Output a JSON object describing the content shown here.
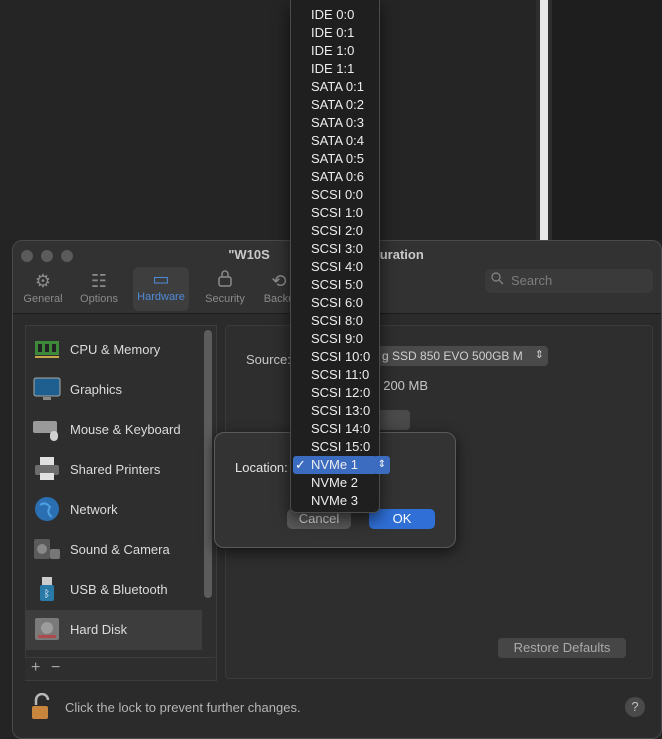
{
  "window": {
    "title": "\"W10S",
    "title_tail": "guration"
  },
  "toolbar": [
    {
      "label": "General",
      "icon": "gear-icon",
      "glyph": "⚙"
    },
    {
      "label": "Options",
      "icon": "sliders-icon",
      "glyph": "☷"
    },
    {
      "label": "Hardware",
      "icon": "monitor-icon",
      "glyph": "▭"
    },
    {
      "label": "Security",
      "icon": "lock-icon",
      "glyph": "🔒"
    },
    {
      "label": "Backu",
      "icon": "backup-icon",
      "glyph": "⟲"
    }
  ],
  "search": {
    "placeholder": "Search"
  },
  "sidebar": {
    "items": [
      {
        "label": "CPU & Memory",
        "icon": "cpu-icon",
        "color": "#3f8a3a"
      },
      {
        "label": "Graphics",
        "icon": "monitor-icon",
        "color": "#1f5f8f"
      },
      {
        "label": "Mouse & Keyboard",
        "icon": "keyboard-icon",
        "color": "#8a8a8a"
      },
      {
        "label": "Shared Printers",
        "icon": "printer-icon",
        "color": "#6d6d6d"
      },
      {
        "label": "Network",
        "icon": "globe-icon",
        "color": "#2b6fb3"
      },
      {
        "label": "Sound & Camera",
        "icon": "speaker-icon",
        "color": "#5a5a5a"
      },
      {
        "label": "USB & Bluetooth",
        "icon": "usb-icon",
        "color": "#2a7aa8"
      },
      {
        "label": "Hard Disk",
        "icon": "harddisk-icon",
        "color": "#7a7a7a"
      }
    ],
    "add": "+",
    "remove": "−"
  },
  "panel": {
    "source_label": "Source:",
    "source_value": "g SSD 850 EVO 500GB M",
    "size_text": ": 200 MB",
    "restore_label": "Restore Defaults"
  },
  "lock_text": "Click the lock to prevent further changes.",
  "help": "?",
  "sheet": {
    "location_label": "Location:",
    "cancel": "Cancel",
    "ok": "OK"
  },
  "menu": {
    "options": [
      "IDE 0:0",
      "IDE 0:1",
      "IDE 1:0",
      "IDE 1:1",
      "SATA 0:1",
      "SATA 0:2",
      "SATA 0:3",
      "SATA 0:4",
      "SATA 0:5",
      "SATA 0:6",
      "SCSI 0:0",
      "SCSI 1:0",
      "SCSI 2:0",
      "SCSI 3:0",
      "SCSI 4:0",
      "SCSI 5:0",
      "SCSI 6:0",
      "SCSI 8:0",
      "SCSI 9:0",
      "SCSI 10:0",
      "SCSI 11:0",
      "SCSI 12:0",
      "SCSI 13:0",
      "SCSI 14:0",
      "SCSI 15:0",
      "NVMe 1",
      "NVMe 2",
      "NVMe 3"
    ],
    "selected": "NVMe 1",
    "check": "✓"
  },
  "colors": {
    "accent": "#2f6fd6",
    "menu_highlight": "#3c6cbf"
  }
}
